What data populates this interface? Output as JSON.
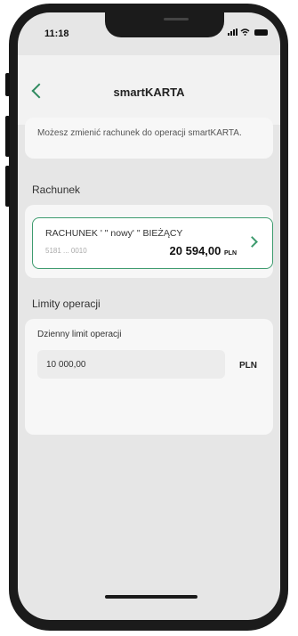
{
  "status_bar": {
    "time": "11:18"
  },
  "header": {
    "title": "smartKARTA"
  },
  "info": {
    "text": "Możesz zmienić rachunek do operacji smartKARTA."
  },
  "account_section": {
    "label": "Rachunek",
    "account": {
      "name": "RACHUNEK ' \" nowy' \" BIEŻĄCY",
      "number": "5181 ... 0010",
      "balance": "20 594,00",
      "currency": "PLN"
    }
  },
  "limits_section": {
    "label": "Limity operacji",
    "daily_limit": {
      "label": "Dzienny limit operacji",
      "value": "10 000,00",
      "currency": "PLN"
    }
  },
  "colors": {
    "accent": "#3d9b6e",
    "background": "#e6e6e6"
  }
}
